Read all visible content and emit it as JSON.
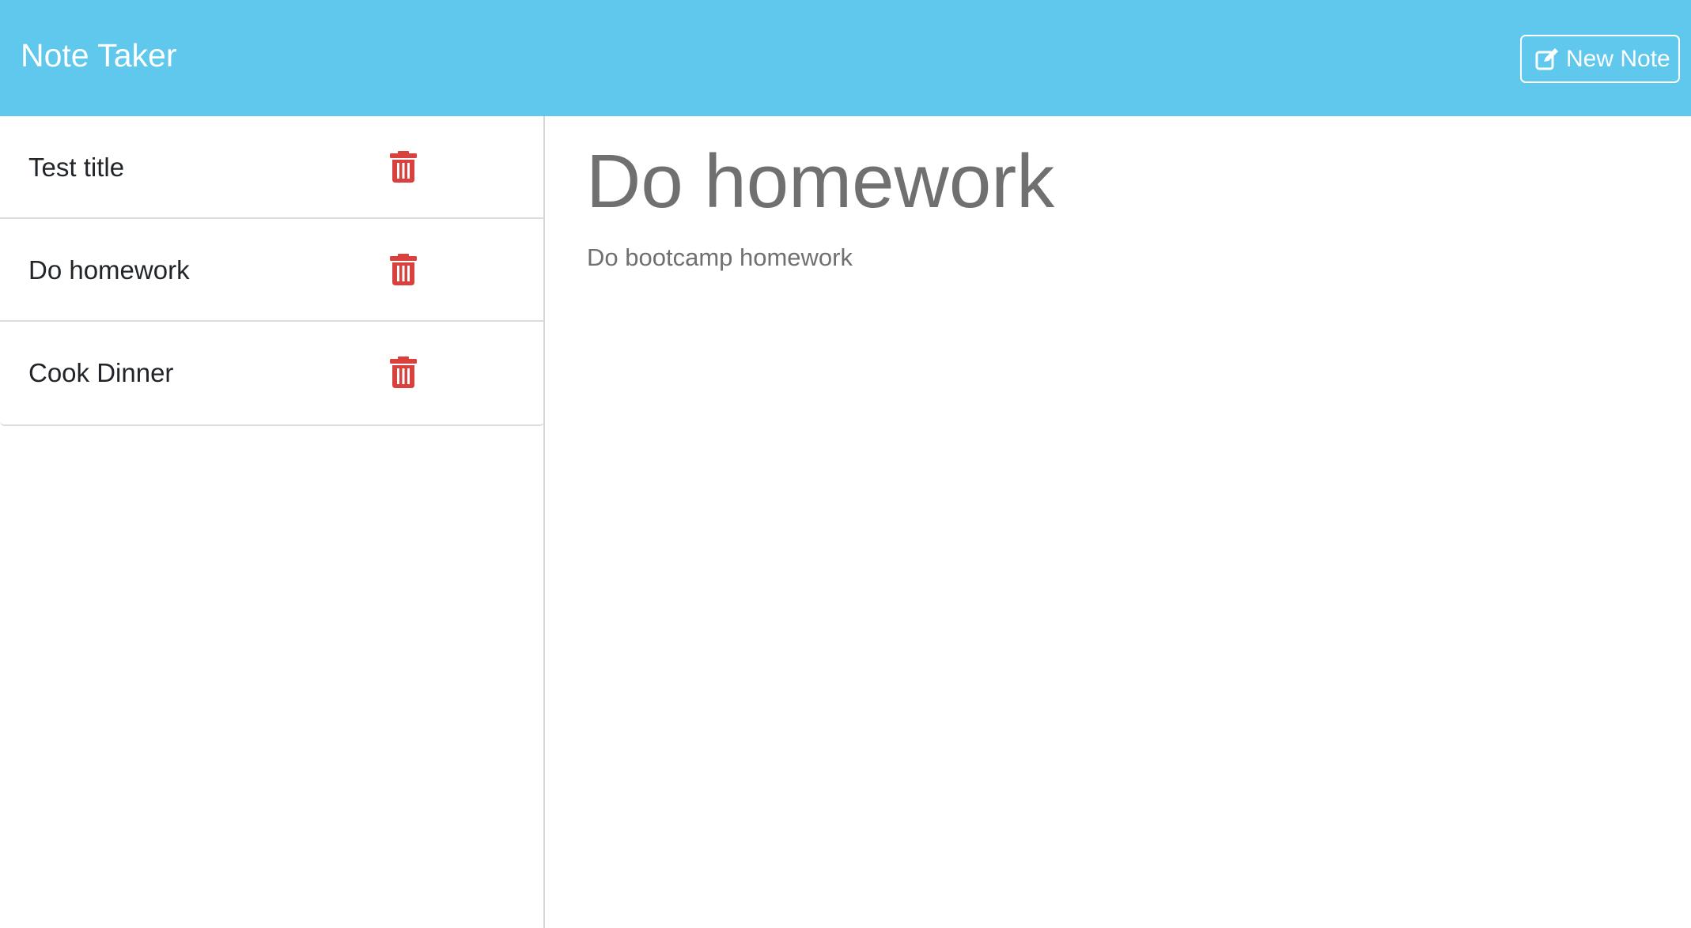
{
  "app": {
    "title": "Note Taker"
  },
  "toolbar": {
    "new_note_label": "New Note",
    "new_note_icon": "pen-to-square-icon"
  },
  "notes": [
    {
      "title": "Test title"
    },
    {
      "title": "Do homework"
    },
    {
      "title": "Cook Dinner"
    }
  ],
  "active_note": {
    "title": "Do homework",
    "body": "Do bootcamp homework"
  },
  "colors": {
    "navbar": "#5fc8ec",
    "delete": "#d9413f",
    "note_text": "#707070"
  },
  "icons": {
    "delete": "trash-icon"
  }
}
